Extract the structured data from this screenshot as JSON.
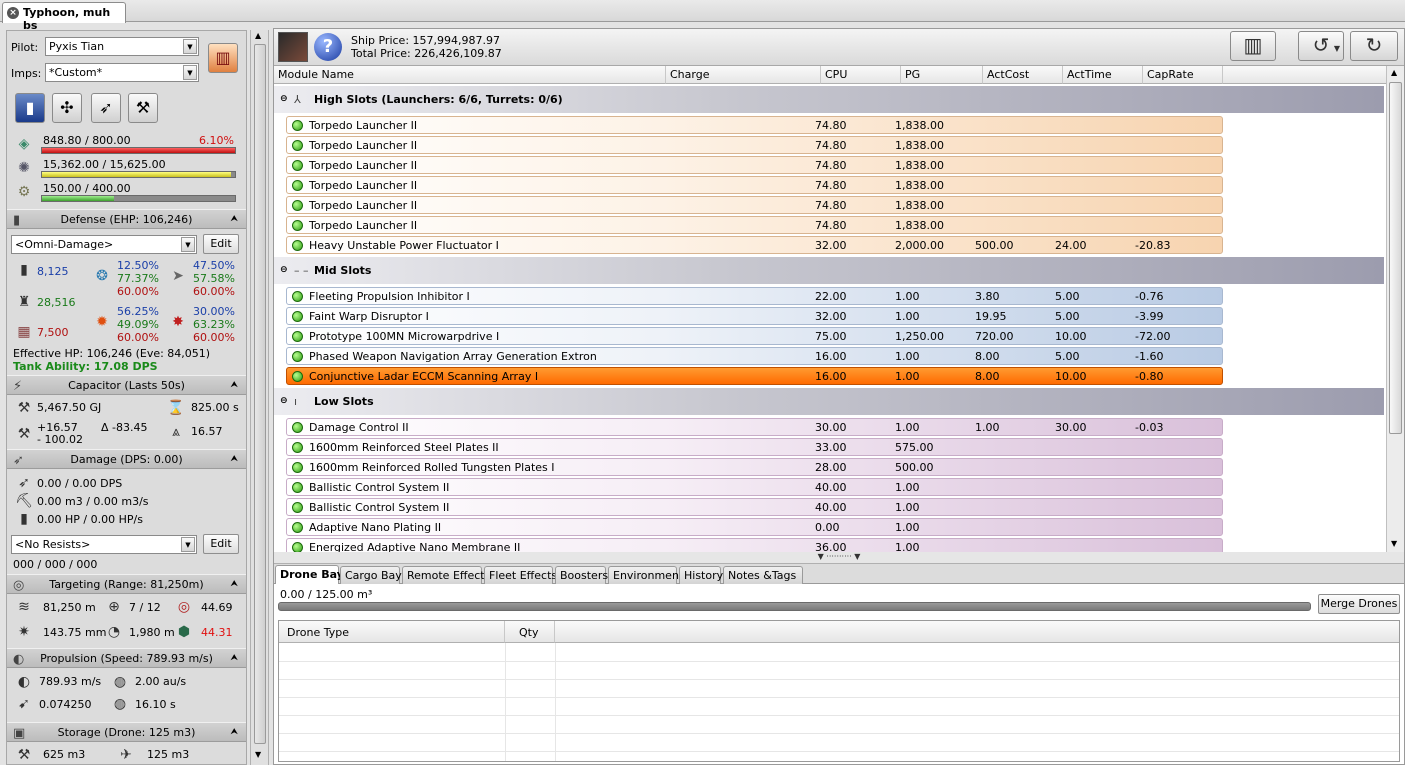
{
  "tab": {
    "title": "Typhoon, muh bs"
  },
  "pilot": {
    "label": "Pilot:",
    "value": "Pyxis Tian"
  },
  "imps": {
    "label": "Imps:",
    "value": "*Custom*"
  },
  "resources": {
    "cpu": {
      "text": "848.80 / 800.00",
      "pct": "6.10%",
      "fill": 1.0
    },
    "power": {
      "text": "15,362.00 / 15,625.00",
      "fill": 0.98
    },
    "calibration": {
      "text": "150.00 / 400.00",
      "fill": 0.375
    }
  },
  "defense": {
    "header": "Defense (EHP: 106,246)",
    "damage_profile": "<Omni-Damage>",
    "edit": "Edit",
    "shield_hp": "8,125",
    "armor_hp": "28,516",
    "hull_hp": "7,500",
    "r1": [
      "12.50%",
      "77.37%",
      "60.00%"
    ],
    "r2": [
      "47.50%",
      "57.58%",
      "60.00%"
    ],
    "r3": [
      "56.25%",
      "49.09%",
      "60.00%"
    ],
    "r4": [
      "30.00%",
      "63.23%",
      "60.00%"
    ],
    "ehp": "Effective HP: 106,246 (Eve: 84,051)",
    "tank": "Tank Ability: 17.08 DPS"
  },
  "capacitor": {
    "header": "Capacitor (Lasts 50s)",
    "amount": "5,467.50 GJ",
    "recharge": "825.00 s",
    "delta_top": "+16.57",
    "delta_bottom": "- 100.02",
    "delta": "Δ -83.45",
    "peak": "16.57"
  },
  "damage": {
    "header": "Damage (DPS: 0.00)",
    "dps": "0.00 / 0.00 DPS",
    "mining": "0.00 m3 / 0.00 m3/s",
    "repair": "0.00 HP / 0.00 HP/s",
    "resists": "<No Resists>",
    "edit": "Edit",
    "totals": "000 / 000 / 000"
  },
  "targeting": {
    "header": "Targeting (Range: 81,250m)",
    "range": "81,250 m",
    "targets": "7 / 12",
    "scan": "44.69",
    "sig": "143.75 mm",
    "lock": "1,980 m",
    "sensor": "44.31"
  },
  "propulsion": {
    "header": "Propulsion (Speed: 789.93 m/s)",
    "speed": "789.93 m/s",
    "warp": "2.00 au/s",
    "agility": "0.074250",
    "align": "16.10 s"
  },
  "storage": {
    "header": "Storage (Drone: 125 m3)",
    "cargo": "625 m3",
    "drone": "125 m3"
  },
  "prices": {
    "ship": "Ship Price: 157,994,987.97",
    "total": "Total Price: 226,426,109.87"
  },
  "columns": [
    "Module Name",
    "Charge",
    "CPU",
    "PG",
    "ActCost",
    "ActTime",
    "CapRate"
  ],
  "high": {
    "title": "High Slots (Launchers: 6/6, Turrets: 0/6)",
    "rows": [
      {
        "name": "Torpedo Launcher II",
        "charge": "",
        "cpu": "74.80",
        "pg": "1,838.00",
        "cost": "",
        "time": "",
        "rate": ""
      },
      {
        "name": "Torpedo Launcher II",
        "charge": "",
        "cpu": "74.80",
        "pg": "1,838.00",
        "cost": "",
        "time": "",
        "rate": ""
      },
      {
        "name": "Torpedo Launcher II",
        "charge": "",
        "cpu": "74.80",
        "pg": "1,838.00",
        "cost": "",
        "time": "",
        "rate": ""
      },
      {
        "name": "Torpedo Launcher II",
        "charge": "",
        "cpu": "74.80",
        "pg": "1,838.00",
        "cost": "",
        "time": "",
        "rate": ""
      },
      {
        "name": "Torpedo Launcher II",
        "charge": "",
        "cpu": "74.80",
        "pg": "1,838.00",
        "cost": "",
        "time": "",
        "rate": ""
      },
      {
        "name": "Torpedo Launcher II",
        "charge": "",
        "cpu": "74.80",
        "pg": "1,838.00",
        "cost": "",
        "time": "",
        "rate": ""
      },
      {
        "name": "Heavy Unstable Power Fluctuator I",
        "charge": "",
        "cpu": "32.00",
        "pg": "2,000.00",
        "cost": "500.00",
        "time": "24.00",
        "rate": "-20.83"
      }
    ]
  },
  "mid": {
    "title": "Mid Slots",
    "rows": [
      {
        "name": "Fleeting Propulsion Inhibitor I",
        "charge": "",
        "cpu": "22.00",
        "pg": "1.00",
        "cost": "3.80",
        "time": "5.00",
        "rate": "-0.76"
      },
      {
        "name": "Faint Warp Disruptor I",
        "charge": "",
        "cpu": "32.00",
        "pg": "1.00",
        "cost": "19.95",
        "time": "5.00",
        "rate": "-3.99"
      },
      {
        "name": "Prototype 100MN Microwarpdrive I",
        "charge": "",
        "cpu": "75.00",
        "pg": "1,250.00",
        "cost": "720.00",
        "time": "10.00",
        "rate": "-72.00"
      },
      {
        "name": "Phased Weapon Navigation Array Generation Extron",
        "charge": "",
        "cpu": "16.00",
        "pg": "1.00",
        "cost": "8.00",
        "time": "5.00",
        "rate": "-1.60"
      },
      {
        "name": "Conjunctive Ladar ECCM Scanning Array I",
        "charge": "",
        "cpu": "16.00",
        "pg": "1.00",
        "cost": "8.00",
        "time": "10.00",
        "rate": "-0.80"
      }
    ]
  },
  "low": {
    "title": "Low Slots",
    "rows": [
      {
        "name": "Damage Control II",
        "charge": "",
        "cpu": "30.00",
        "pg": "1.00",
        "cost": "1.00",
        "time": "30.00",
        "rate": "-0.03"
      },
      {
        "name": "1600mm Reinforced Steel Plates II",
        "charge": "",
        "cpu": "33.00",
        "pg": "575.00",
        "cost": "",
        "time": "",
        "rate": ""
      },
      {
        "name": "1600mm Reinforced Rolled Tungsten Plates I",
        "charge": "",
        "cpu": "28.00",
        "pg": "500.00",
        "cost": "",
        "time": "",
        "rate": ""
      },
      {
        "name": "Ballistic Control System II",
        "charge": "",
        "cpu": "40.00",
        "pg": "1.00",
        "cost": "",
        "time": "",
        "rate": ""
      },
      {
        "name": "Ballistic Control System II",
        "charge": "",
        "cpu": "40.00",
        "pg": "1.00",
        "cost": "",
        "time": "",
        "rate": ""
      },
      {
        "name": "Adaptive Nano Plating II",
        "charge": "",
        "cpu": "0.00",
        "pg": "1.00",
        "cost": "",
        "time": "",
        "rate": ""
      },
      {
        "name": "Energized Adaptive Nano Membrane II",
        "charge": "",
        "cpu": "36.00",
        "pg": "1.00",
        "cost": "",
        "time": "",
        "rate": ""
      }
    ]
  },
  "bottom_tabs": [
    "Drone Bay",
    "Cargo Bay",
    "Remote Effects",
    "Fleet Effects",
    "Boosters",
    "Environment",
    "History",
    "Notes &Tags"
  ],
  "dronebay": {
    "capacity": "0.00 / 125.00 m³",
    "merge": "Merge Drones",
    "col_type": "Drone Type",
    "col_qty": "Qty"
  },
  "colors": {
    "selected_row": "#ff6a00",
    "high": "#f7d4b0",
    "mid": "#b9cbe4",
    "low": "#d9c0da"
  }
}
